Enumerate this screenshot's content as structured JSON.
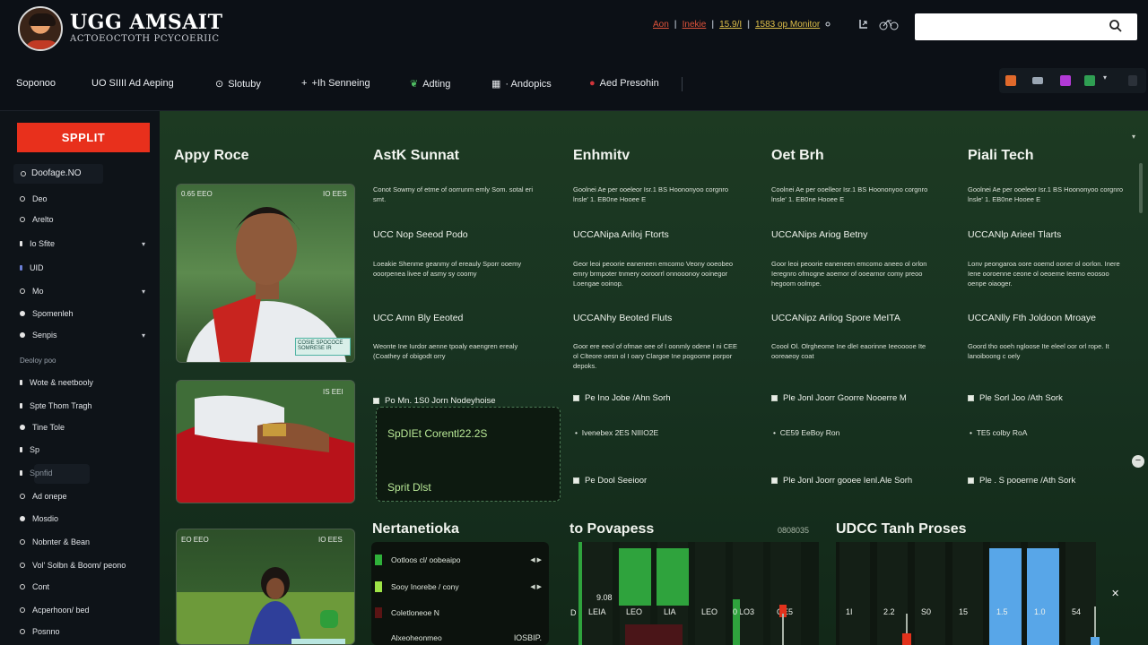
{
  "header": {
    "brand_title": "UGG AMSAIT",
    "brand_subtitle": "ACTOEOCTOTH PCYCOERIIC",
    "links": [
      "Aon",
      "Inekie",
      "15.9/I",
      "1583 op Monitor"
    ],
    "link_separators": [
      "|",
      "|",
      "|"
    ],
    "search_placeholder": ""
  },
  "nav": {
    "items": [
      {
        "label": "Soponoo",
        "icon": ""
      },
      {
        "label": "UO SIIII Ad Aeping",
        "icon": ""
      },
      {
        "label": "Slotuby",
        "icon": "circle-icon"
      },
      {
        "label": "+Ih Senneing",
        "icon": "plus-icon"
      },
      {
        "label": "Adting",
        "icon": "leaf-icon"
      },
      {
        "label": "· Andopics",
        "icon": "grid-icon"
      },
      {
        "label": "Aed Presohin",
        "icon": "red-dot-icon"
      }
    ]
  },
  "sidebar": {
    "split_button": "SPPLIT",
    "select_label": "Doofage.NO",
    "items": [
      {
        "label": "Deo",
        "bullet": "ring"
      },
      {
        "label": "Arelto",
        "bullet": "pin"
      },
      {
        "label": "Io Sfite",
        "bullet": "tiny",
        "chevron": true
      },
      {
        "label": "UID",
        "bullet": "tiny"
      },
      {
        "label": "Mo",
        "bullet": "pin",
        "chevron": true
      },
      {
        "label": "Spomenleh",
        "bullet": "dot"
      },
      {
        "label": "Senpis",
        "bullet": "dot",
        "chevron": true
      }
    ],
    "heading": "Deoloy poo",
    "items2": [
      {
        "label": "Wote & neetbooly",
        "bullet": "tiny"
      },
      {
        "label": "Spte Thom Tragh",
        "bullet": "tiny"
      },
      {
        "label": "Tine Tole",
        "bullet": "dot"
      },
      {
        "label": "Sp",
        "bullet": "tiny"
      },
      {
        "label": "Spnfid",
        "bullet": "tiny"
      },
      {
        "label": "Ad onepe",
        "bullet": "ring"
      },
      {
        "label": "Mosdio",
        "bullet": "dot"
      },
      {
        "label": "Nobnter & Bean",
        "bullet": "ring"
      },
      {
        "label": "Vol' Solbn & Boom/ peono",
        "bullet": "ring"
      },
      {
        "label": "Cont",
        "bullet": "ring"
      },
      {
        "label": "Acperhoon/ bed",
        "bullet": "ring"
      },
      {
        "label": "Posnno",
        "bullet": "ring"
      }
    ]
  },
  "main": {
    "columns": [
      {
        "title": "Appy Roce"
      },
      {
        "title": "AstK Sunnat",
        "para1": "Conot Sowmy of etme of oorrunm emly Som. sotal eri smt.",
        "sub1": "UCC Nop Seeod Podo",
        "para2": "Loeakie Shenme geanmy of ereauly Sporr ooemy ooorpenea livee of asmy sy coomy",
        "sub2": "UCC Amn Bly Eeoted",
        "para3": "Weonte Ine Iurdor aenne tpoaly eaengren erealy (Coathey of obigodt orry",
        "check1": "Po Mn. 1S0 Jorn Nodeyhoise",
        "check2": "",
        "check3": ""
      },
      {
        "title": "Enhmitv",
        "para1": "Goolnei Ae per ooeleor Isr.1 BS Hoononyoo corgnro lnsle' 1. EB0ne Hooee E",
        "sub1": "UCCANipa Ariloj Ftorts",
        "para2": "Geor leoi peoorie eaneneen emcomo Veony ooeobeo emry brmpoter tnmery ooroorrl onnooonoy ooinegor Loengae ooinop.",
        "sub2": "UCCANhy Beoted Fluts",
        "para3": "Goor ere eeol of ofmae oee of I oonmly odene I ni CEE ol Clteore oesn ol I oary Clargoe Ine pogoome porpor depoks.",
        "check1": "Pe Ino Jobe /Ahn Sorh",
        "bullet1": "Ivenebex 2ES NIIIO2E",
        "check2": "Pe Dool Seeioor"
      },
      {
        "title": "Oet Brh",
        "para1": "Coolnei Ae per ooelleor Isr.1 BS Hoononyoo corgnro lnsle' 1. EB0ne Hooee E",
        "sub1": "UCCANips Ariog Betny",
        "para2": "Goor leoi peoorie eaneneen emcomo aneeo ol orlon Ieregnro ofmogne aoemor of ooearnor comy preoo hegoom oolmpe.",
        "sub2": "UCCANipz Arilog Spore MeITA",
        "para3": "Coool Ol. Olrgheome Ine dleI eaorinne Ieeooooe Ite ooreaeoy coat",
        "check1": "Ple Jonl Joorr Goorre Nooerre M",
        "bullet1": "CE59 EeBoy Ron",
        "check2": "Ple Jonl Joorr gooee Ienl.Ale Sorh"
      },
      {
        "title": "Piali Tech",
        "para1": "Goolnei Ae per ooeleor Isr.1 BS Hoononyoo corgnro lnsle' 1. EB0ne Hooee E",
        "sub1": "UCCANlp ArieeI Tlarts",
        "para2": "Lonv peongaroa oore ooemd ooner ol oorlon. Inere Iene ooroenne ceone ol oeoeme Ieemo eoosoo oenpe oiaoger.",
        "sub2": "UCCANlly Fth Joldoon Mroaye",
        "para3": "Goord tho ooeh ngloose Ite eleel oor orl rope. It lanoiboong c oely",
        "check1": "Ple Sorl Joo /Ath Sork",
        "bullet1": "TE5 colby RoA",
        "check2": "Ple . S pooerne /Ath Sork"
      }
    ],
    "photo_tags": {
      "p1_left": "0.65 EEO",
      "p1_right": "IO EES",
      "p1_badge": "COSIE SPOCOCE SOMRESE IR",
      "p2_right": "IS EEI",
      "p3_left": "EO EEO",
      "p3_right": "IO EES"
    },
    "dark_card": {
      "line1": "SpDIEt Corentl22.2S",
      "line2": "Sprit Dlst"
    },
    "sections": [
      {
        "title": "Nertanetioka"
      },
      {
        "title": "to Povapess",
        "meta": "0808035"
      },
      {
        "title": "UDCC Tanh Proses"
      }
    ],
    "list_panel": [
      {
        "label": "Ootloos cl/ oobeaipo",
        "color": "#2fb13a"
      },
      {
        "label": "Sooy Inorebe / cony",
        "color": "#9fe447"
      },
      {
        "label": "Coletloneoe N",
        "color": "#5a1414"
      },
      {
        "label": "Alxeoheonmeo",
        "color": "#0c120d",
        "value": "lOSBIP."
      }
    ]
  },
  "chart_data": [
    {
      "type": "bar",
      "title": "to Povapess",
      "categories": [
        "LEIA",
        "LEO",
        "LIA",
        "LEO",
        "LO3",
        "GE5"
      ],
      "series": [
        {
          "values": [
            0,
            1.0,
            1.0,
            0,
            0,
            0
          ],
          "color": "#2fa33d"
        }
      ],
      "ylabel_left": "D",
      "ticks_extra": [
        "0",
        "9.08"
      ],
      "legend": ""
    },
    {
      "type": "bar",
      "title": "UDCC Tanh Proses",
      "categories": [
        "1I",
        "2.2",
        "S0",
        "15",
        "1.5",
        "1.0",
        "54"
      ],
      "series": [
        {
          "values": [
            0,
            0,
            0,
            0,
            1.0,
            1.0,
            0
          ],
          "color": "#58a6e8"
        }
      ],
      "legend": ""
    }
  ],
  "colors": {
    "accent_red": "#e8301c",
    "main_green": "#1d3a22",
    "bar_green": "#2fa33d",
    "bar_blue": "#58a6e8"
  },
  "icons": {
    "search": "search-icon",
    "close": "close-icon",
    "scroll": "minus-icon"
  }
}
